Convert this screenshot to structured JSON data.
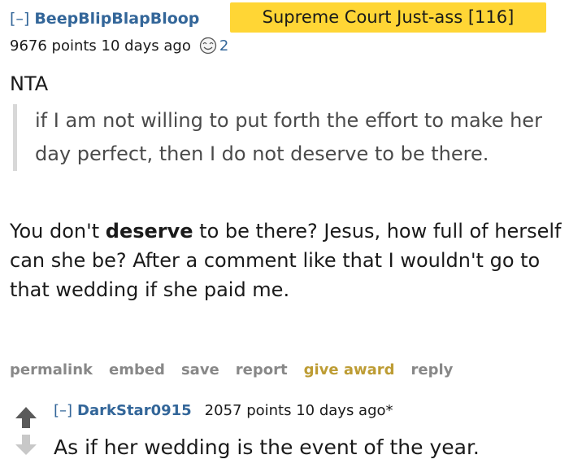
{
  "comment": {
    "collapse_label": "[–]",
    "author": "BeepBlipBlapBloop",
    "flair": "Supreme Court Just-ass [116]",
    "meta": "9676 points 10 days ago",
    "award_icon": "award-face-icon",
    "award_count": "2",
    "opening": "NTA",
    "quote": "if I am not willing to put forth the effort to make her day perfect, then I do not deserve to be there.",
    "body_before_bold": "You don't ",
    "body_bold": "deserve",
    "body_after_bold": " to be there? Jesus, how full of herself can she be? After a comment like that I wouldn't go to that wedding if she paid me.",
    "actions": {
      "permalink": "permalink",
      "embed": "embed",
      "save": "save",
      "report": "report",
      "give_award": "give award",
      "reply": "reply"
    }
  },
  "reply": {
    "upvote_icon": "upvote-arrow-icon",
    "downvote_icon": "downvote-arrow-icon",
    "collapse_label": "[–]",
    "author": "DarkStar0915",
    "meta": "2057 points 10 days ago*",
    "body": "As if her wedding is the event of the year."
  },
  "colors": {
    "link_blue": "#336699",
    "flair_yellow": "#ffd635",
    "award_gold": "#bd9c34",
    "muted_gray": "#888888",
    "quote_bar": "#d8d8d8"
  }
}
